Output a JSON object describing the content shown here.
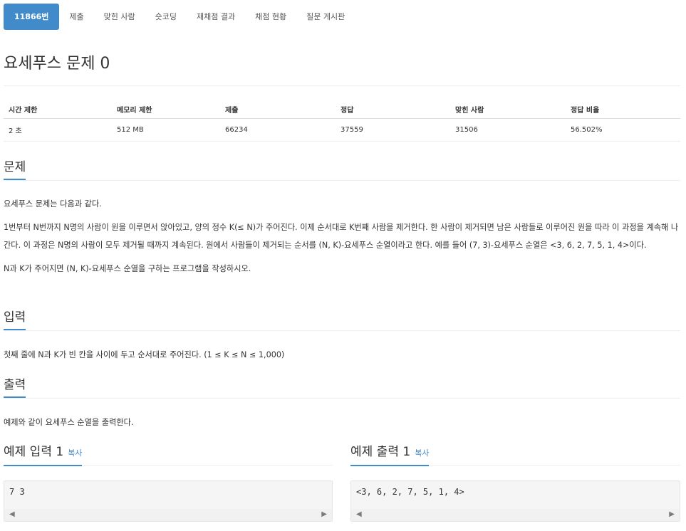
{
  "nav": {
    "tabs": [
      {
        "label": "11866번",
        "active": true
      },
      {
        "label": "제출"
      },
      {
        "label": "맞힌 사람"
      },
      {
        "label": "숏코딩"
      },
      {
        "label": "재채점 결과"
      },
      {
        "label": "채점 현황"
      },
      {
        "label": "질문 게시판"
      }
    ]
  },
  "problem": {
    "title": "요세푸스 문제 0"
  },
  "info_table": {
    "headers": [
      "시간 제한",
      "메모리 제한",
      "제출",
      "정답",
      "맞힌 사람",
      "정답 비율"
    ],
    "values": [
      "2 초",
      "512 MB",
      "66234",
      "37559",
      "31506",
      "56.502%"
    ]
  },
  "description": {
    "heading": "문제",
    "paragraphs": [
      "요세푸스 문제는 다음과 같다.",
      "1번부터 N번까지 N명의 사람이 원을 이루면서 앉아있고, 양의 정수 K(≤ N)가 주어진다. 이제 순서대로 K번째 사람을 제거한다. 한 사람이 제거되면 남은 사람들로 이루어진 원을 따라 이 과정을 계속해 나간다. 이 과정은 N명의 사람이 모두 제거될 때까지 계속된다. 원에서 사람들이 제거되는 순서를 (N, K)-요세푸스 순열이라고 한다. 예를 들어 (7, 3)-요세푸스 순열은 <3, 6, 2, 7, 5, 1, 4>이다.",
      "N과 K가 주어지면 (N, K)-요세푸스 순열을 구하는 프로그램을 작성하시오."
    ]
  },
  "input": {
    "heading": "입력",
    "text": "첫째 줄에 N과 K가 빈 칸을 사이에 두고 순서대로 주어진다. (1 ≤ K ≤ N ≤ 1,000)"
  },
  "output": {
    "heading": "출력",
    "text": "예제와 같이 요세푸스 순열을 출력한다."
  },
  "samples": {
    "input": {
      "heading": "예제 입력 1",
      "copy_label": "복사",
      "code": "7 3"
    },
    "output": {
      "heading": "예제 출력 1",
      "copy_label": "복사",
      "code": "<3, 6, 2, 7, 5, 1, 4>"
    }
  },
  "colors": {
    "accent": "#428bca"
  }
}
